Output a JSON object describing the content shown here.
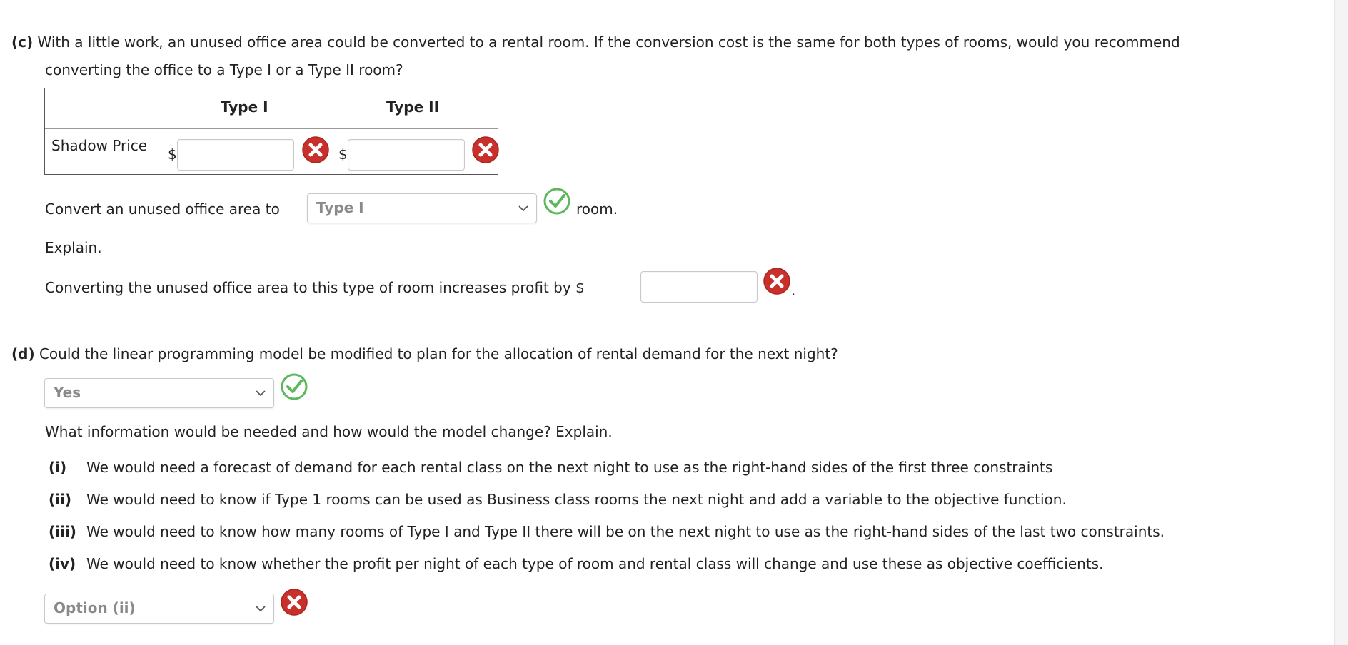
{
  "part_c": {
    "label": "(c)",
    "question_line1": "With a little work, an unused office area could be converted to a rental room. If the conversion cost is the same for both types of rooms, would you recommend",
    "question_line2": "converting the office to a Type I or a Type II room?",
    "table": {
      "col1": "Type I",
      "col2": "Type II",
      "row_label": "Shadow Price",
      "currency": "$",
      "type1_value": "",
      "type2_value": ""
    },
    "convert_prefix": "Convert an unused office area to",
    "convert_select": "Type I",
    "convert_suffix": "room.",
    "explain": "Explain.",
    "profit_text": "Converting the unused office area to this type of room increases profit by $",
    "profit_value": "",
    "profit_end": "."
  },
  "part_d": {
    "label": "(d)",
    "question": "Could the linear programming model be modified to plan for the allocation of rental demand for the next night?",
    "answer_select": "Yes",
    "followup": "What information would be needed and how would the model change? Explain.",
    "options": [
      {
        "label": "(i)",
        "text": "We would need a forecast of demand for each rental class on the next night to use as the right-hand sides of the first three constraints"
      },
      {
        "label": "(ii)",
        "text": "We would need to know if Type 1 rooms can be used as Business class rooms the next night and add a variable to the objective function."
      },
      {
        "label": "(iii)",
        "text": "We would need to know how many rooms of Type I and Type II there will be on the next night to use as the right-hand sides of the last two constraints."
      },
      {
        "label": "(iv)",
        "text": "We would need to know whether the profit per night of each type of room and rental class will change and use these as objective coefficients."
      }
    ],
    "option_select": "Option (ii)"
  },
  "colors": {
    "correct": "#5cb85c",
    "incorrect": "#c9302c"
  }
}
